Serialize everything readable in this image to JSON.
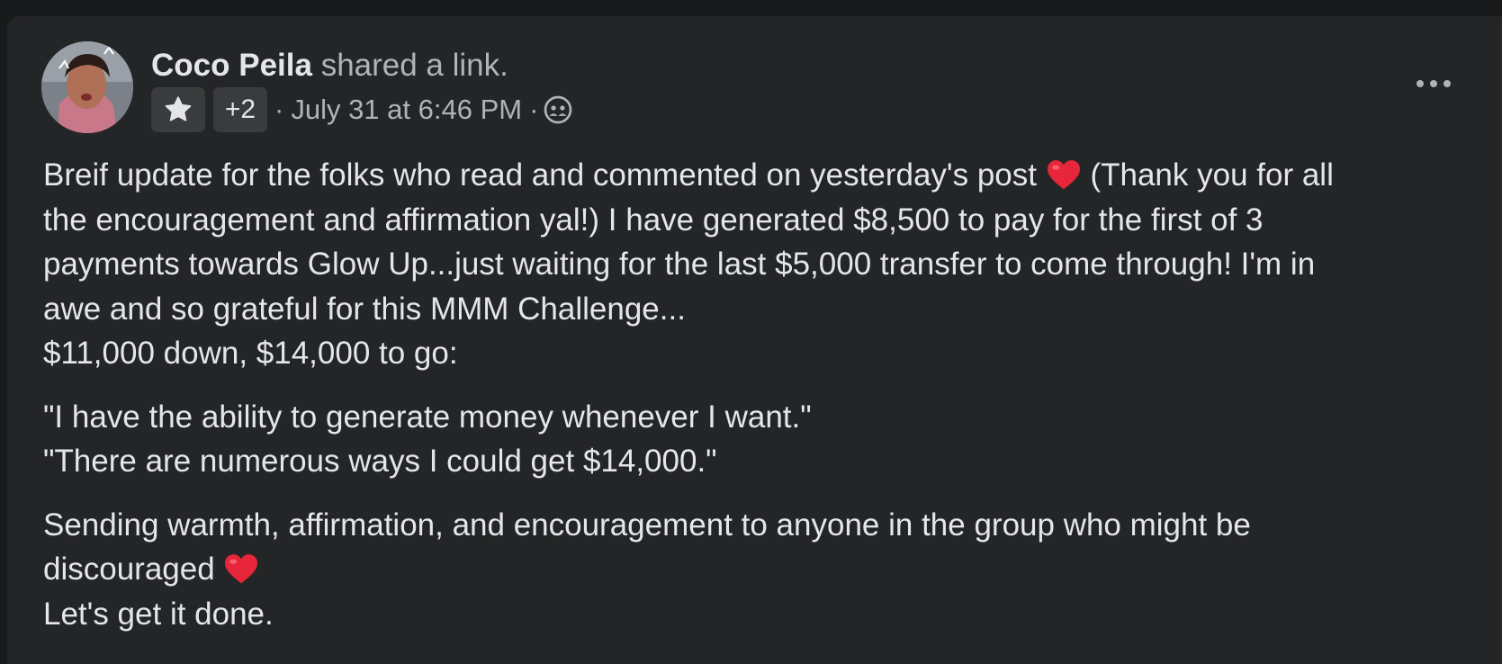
{
  "post": {
    "author": "Coco Peila",
    "action": "shared a link.",
    "badge_extra": "+2",
    "meta_separator": "·",
    "timestamp": "July 31 at 6:46 PM",
    "audience_icon": "group-icon",
    "more_icon": "more-options-icon",
    "lines": {
      "l1a": "Breif update for the folks who read and commented on yesterday's post",
      "l1b": "(Thank you for all",
      "l2": "the encouragement and affirmation yal!) I have generated $8,500 to pay for the first of 3",
      "l3": "payments towards Glow Up...just waiting for the last $5,000 transfer to come through! I'm in",
      "l4": "awe and so grateful for this MMM Challenge...",
      "l5": "$11,000 down, $14,000 to go:",
      "l6": "\"I have the ability to generate money whenever I want.\"",
      "l7": "\"There are numerous ways I could get $14,000.\"",
      "l8": "Sending warmth, affirmation, and encouragement to anyone in the group who might be",
      "l9": "discouraged",
      "l10": "Let's get it done."
    }
  },
  "colors": {
    "page_bg": "#18191a",
    "card_bg": "#242526",
    "text_primary": "#e4e6eb",
    "text_secondary": "#b0b3b8",
    "badge_bg": "#3a3b3c",
    "heart": "#e8263b"
  }
}
